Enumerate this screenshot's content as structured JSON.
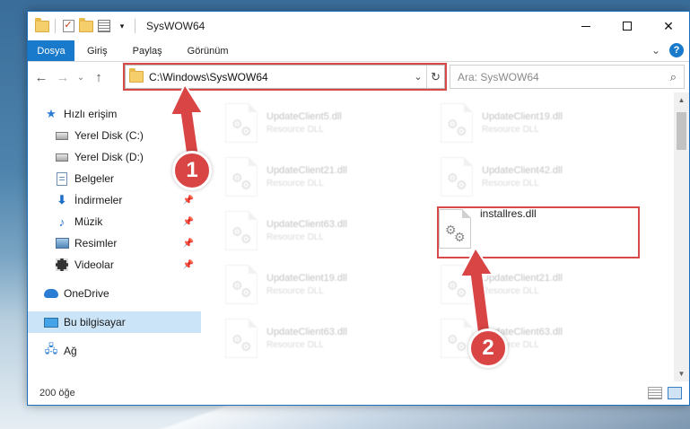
{
  "window": {
    "title": "SysWOW64",
    "controls": {
      "minimize": "minimize-icon",
      "maximize": "maximize-icon",
      "close": "✕"
    }
  },
  "ribbon": {
    "tabs": [
      "Dosya",
      "Giriş",
      "Paylaş",
      "Görünüm"
    ],
    "accent": "#1979ca"
  },
  "address": {
    "path": "C:\\Windows\\SysWOW64",
    "search_placeholder": "Ara: SysWOW64"
  },
  "sidebar": {
    "quick_access": "Hızlı erişim",
    "items": [
      {
        "label": "Yerel Disk (C:)",
        "icon": "drive-icon",
        "pinned": true
      },
      {
        "label": "Yerel Disk (D:)",
        "icon": "drive-icon",
        "pinned": false
      },
      {
        "label": "Belgeler",
        "icon": "documents-icon",
        "pinned": true
      },
      {
        "label": "İndirmeler",
        "icon": "downloads-icon",
        "pinned": true
      },
      {
        "label": "Müzik",
        "icon": "music-icon",
        "pinned": true
      },
      {
        "label": "Resimler",
        "icon": "pictures-icon",
        "pinned": true
      },
      {
        "label": "Videolar",
        "icon": "videos-icon",
        "pinned": true
      }
    ],
    "onedrive": "OneDrive",
    "this_pc": "Bu bilgisayar",
    "network": "Ağ"
  },
  "files": [
    {
      "name": "UpdateClient5.dll",
      "type": "Resource DLL",
      "faded": true
    },
    {
      "name": "UpdateClient19.dll",
      "type": "Resource DLL",
      "faded": true
    },
    {
      "name": "UpdateClient21.dll",
      "type": "Resource DLL",
      "faded": true
    },
    {
      "name": "UpdateClient42.dll",
      "type": "Resource DLL",
      "faded": true
    },
    {
      "name": "UpdateClient63.dll",
      "type": "Resource DLL",
      "faded": true
    },
    {
      "name": "installres.dll",
      "type": "",
      "faded": false
    },
    {
      "name": "UpdateClient19.dll",
      "type": "Resource DLL",
      "faded": true
    },
    {
      "name": "UpdateClient21.dll",
      "type": "Resource DLL",
      "faded": true
    },
    {
      "name": "UpdateClient63.dll",
      "type": "Resource DLL",
      "faded": true
    },
    {
      "name": "UpdateClient63.dll",
      "type": "Resource DLL",
      "faded": true
    }
  ],
  "status": {
    "count": "200 öğe"
  },
  "annotations": {
    "badge1": "1",
    "badge2": "2",
    "color": "#d94545"
  }
}
